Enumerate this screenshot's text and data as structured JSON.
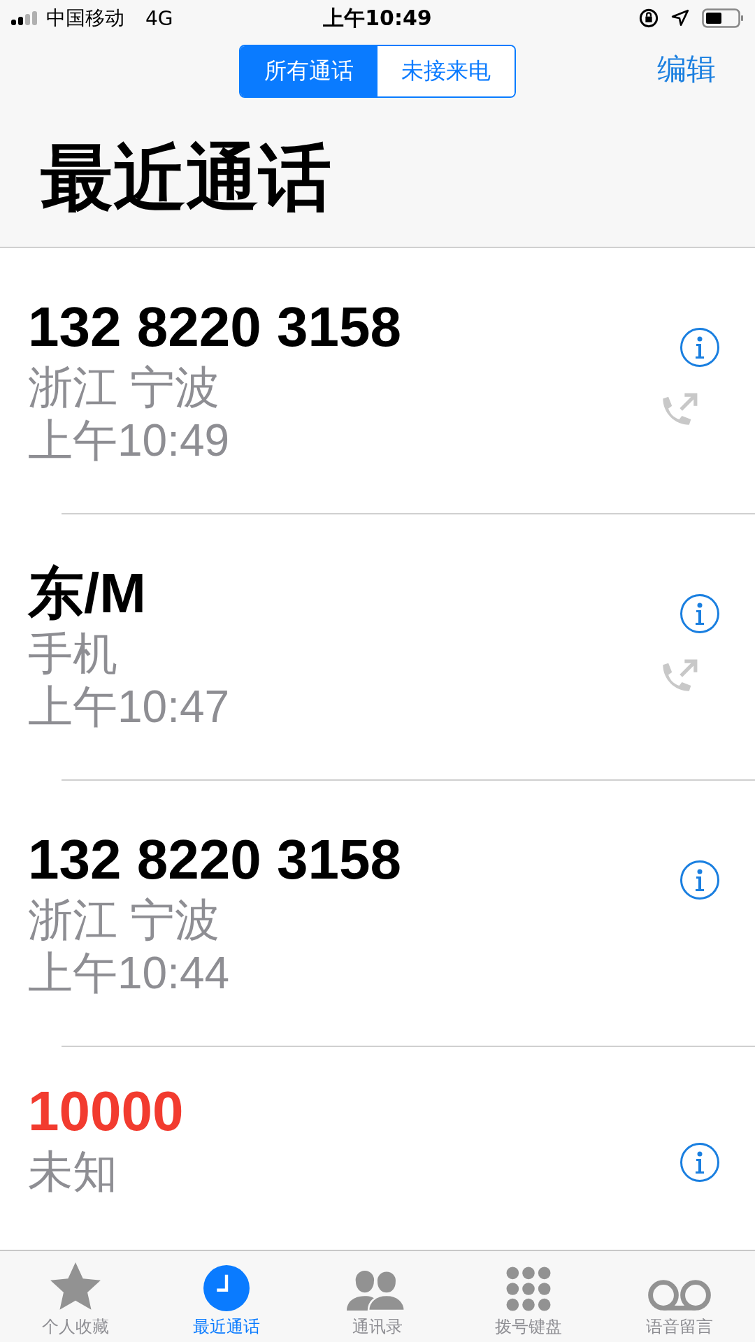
{
  "status_bar": {
    "carrier": "中国移动",
    "network": "4G",
    "time": "上午10:49"
  },
  "segments": [
    {
      "label": "所有通话",
      "selected": true
    },
    {
      "label": "未接来电",
      "selected": false
    }
  ],
  "edit_button": "编辑",
  "title": "最近通话",
  "calls": [
    {
      "name": "132 8220 3158",
      "detail": "浙江 宁波",
      "time": "上午10:49",
      "outgoing": true,
      "missed": false
    },
    {
      "name": "东/M",
      "detail": "手机",
      "time": "上午10:47",
      "outgoing": true,
      "missed": false
    },
    {
      "name": "132 8220 3158",
      "detail": "浙江 宁波",
      "time": "上午10:44",
      "outgoing": false,
      "missed": false
    },
    {
      "name": "10000",
      "detail": "未知",
      "outgoing": false,
      "missed": true
    }
  ],
  "tab_bar": [
    {
      "label": "个人收藏",
      "kind": "star",
      "selected": false
    },
    {
      "label": "最近通话",
      "kind": "clock",
      "selected": true
    },
    {
      "label": "通讯录",
      "kind": "people",
      "selected": false
    },
    {
      "label": "拨号键盘",
      "kind": "keypad",
      "selected": false
    },
    {
      "label": "语音留言",
      "kind": "voicemail",
      "selected": false
    }
  ]
}
